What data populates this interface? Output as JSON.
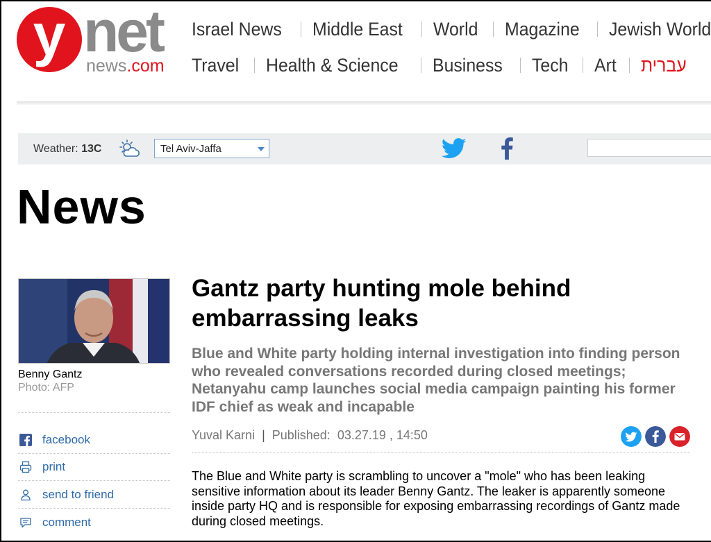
{
  "logo": {
    "y_letter": "y",
    "net_text": "net",
    "domain_prefix": "news",
    "domain_suffix": ".com"
  },
  "nav": {
    "row1": [
      "Israel News",
      "Middle East",
      "World",
      "Magazine",
      "Jewish World"
    ],
    "row2": [
      "Travel",
      "Health & Science",
      "Business",
      "Tech",
      "Art",
      "עברית"
    ]
  },
  "weather": {
    "label": "Weather:",
    "temp": "13C",
    "icon": "partly-cloudy-icon",
    "city": "Tel Aviv-Jaffa"
  },
  "social_top": {
    "twitter": "twitter-icon",
    "facebook": "facebook-icon"
  },
  "section": {
    "title": "News"
  },
  "photo": {
    "caption_name": "Benny Gantz",
    "caption_credit": "Photo: AFP"
  },
  "tools": [
    {
      "icon": "facebook-icon",
      "label": "facebook"
    },
    {
      "icon": "print-icon",
      "label": "print"
    },
    {
      "icon": "send-to-friend-icon",
      "label": "send to friend"
    },
    {
      "icon": "comment-icon",
      "label": "comment"
    }
  ],
  "article": {
    "headline": "Gantz party hunting mole behind embarrassing leaks",
    "subhead": "Blue and White party holding internal investigation into finding person who revealed conversations recorded during closed meetings; Netanyahu camp launches social media campaign painting his former IDF chief as weak and incapable",
    "author": "Yuval Karni",
    "published_label": "Published:",
    "published_date": "03.27.19 , 14:50",
    "share_icons": [
      "twitter-share-icon",
      "facebook-share-icon",
      "email-share-icon"
    ],
    "body": "The Blue and White party is scrambling to uncover a \"mole\" who has been leaking sensitive information about its leader Benny Gantz. The leaker is apparently someone inside party HQ and is responsible for exposing embarrassing recordings of Gantz made during closed meetings."
  },
  "colors": {
    "brand_red": "#e1131c",
    "logo_gray": "#8a8a8a",
    "link_blue": "#2d6aa8",
    "twitter_blue": "#1da1f2",
    "facebook_blue": "#3b5998",
    "weather_bar": "#eceeef"
  }
}
